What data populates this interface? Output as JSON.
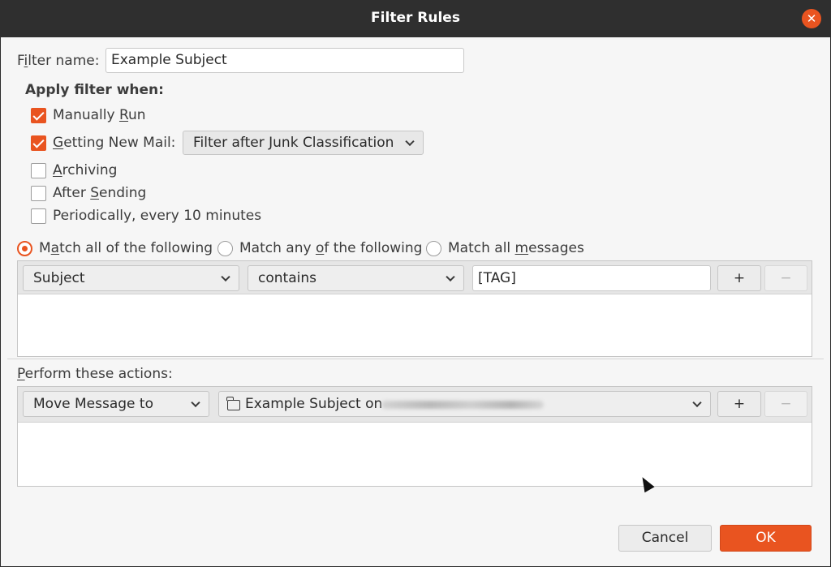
{
  "window": {
    "title": "Filter Rules"
  },
  "filter_name": {
    "label_pre": "",
    "label_ul": "i",
    "label_first": "F",
    "label_rest": "lter name:",
    "value": "Example Subject"
  },
  "apply_when": {
    "heading": "Apply filter when:",
    "manually_run": {
      "pre": "Manually ",
      "ul": "R",
      "post": "un",
      "checked": true
    },
    "getting_new_mail": {
      "pre": "",
      "ul": "G",
      "post": "etting New Mail:",
      "checked": true,
      "dropdown": "Filter after Junk Classification"
    },
    "archiving": {
      "pre": "",
      "ul": "A",
      "post": "rchiving",
      "checked": false
    },
    "after_sending": {
      "pre": "After ",
      "ul": "S",
      "post": "ending",
      "checked": false
    },
    "periodically": {
      "text": "Periodically, every 10 minutes",
      "checked": false
    }
  },
  "match": {
    "all": {
      "pre": "M",
      "ul": "a",
      "post": "tch all of the following",
      "selected": true
    },
    "any": {
      "pre": "Match any ",
      "ul": "o",
      "post": "f the following",
      "selected": false
    },
    "messages": {
      "pre": "Match all ",
      "ul": "m",
      "post": "essages",
      "selected": false
    }
  },
  "rule": {
    "field": "Subject",
    "operator": "contains",
    "value": "[TAG]",
    "add": "+",
    "remove": "−"
  },
  "actions": {
    "label_ul": "P",
    "label_rest": "erform these actions:",
    "action": "Move Message to",
    "target": "Example Subject on",
    "add": "+",
    "remove": "−"
  },
  "buttons": {
    "cancel": "Cancel",
    "ok": "OK"
  },
  "colors": {
    "accent": "#e95420",
    "titlebar": "#2f2f2f",
    "dialog_bg": "#f6f6f6"
  },
  "icons": {
    "close": "close-icon",
    "chevron": "chevron-down-icon",
    "folder": "folder-icon",
    "pointer": "mouse-pointer-icon"
  }
}
